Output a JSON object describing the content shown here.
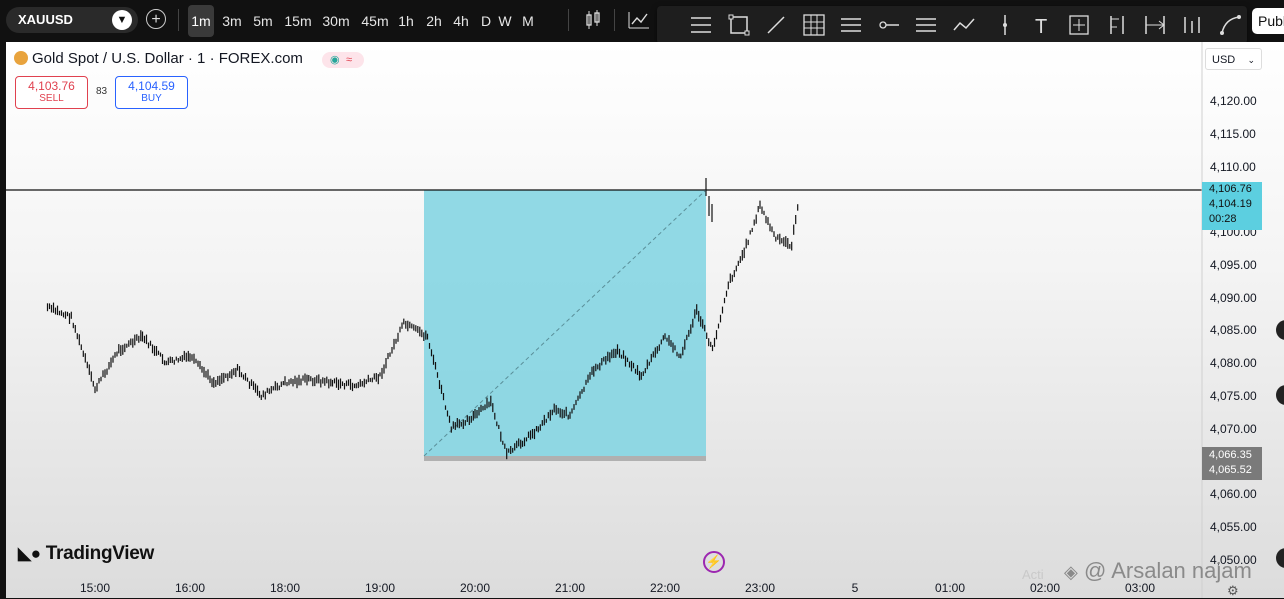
{
  "toolbar": {
    "symbol": "XAUUSD",
    "timeframes": [
      {
        "label": "1m",
        "active": true
      },
      {
        "label": "3m",
        "active": false
      },
      {
        "label": "5m",
        "active": false
      },
      {
        "label": "15m",
        "active": false
      },
      {
        "label": "30m",
        "active": false
      },
      {
        "label": "45m",
        "active": false
      },
      {
        "label": "1h",
        "active": false
      },
      {
        "label": "2h",
        "active": false
      },
      {
        "label": "4h",
        "active": false
      },
      {
        "label": "D",
        "active": false
      },
      {
        "label": "W",
        "active": false
      },
      {
        "label": "M",
        "active": false
      }
    ],
    "publish_label": "Publish"
  },
  "drawing_tools": [
    "fib-retracement-icon",
    "rectangle-icon",
    "trend-line-icon",
    "grid-icon",
    "long-position-icon",
    "horizontal-ray-icon",
    "parallel-channel-icon",
    "path-icon",
    "vertical-line-icon",
    "text-icon",
    "measure-icon",
    "pitchfork-icon",
    "date-range-icon",
    "bars-pattern-icon",
    "curve-icon"
  ],
  "chart": {
    "title": "Gold Spot / U.S. Dollar · 1 · FOREX.com",
    "sell": {
      "price": "4,103.76",
      "label": "SELL"
    },
    "buy": {
      "price": "4,104.59",
      "label": "BUY"
    },
    "spread": "83",
    "currency": "USD",
    "price_tag": {
      "line1": "4,106.76",
      "line2": "4,104.19",
      "line3": "00:28"
    },
    "range_tag": {
      "high": "4,066.35",
      "low": "4,065.52"
    },
    "branding": "TradingView",
    "watermark": "@ Arsalan najam",
    "activate_text": "Acti",
    "colors": {
      "accent": "#7fd3e2",
      "sell": "#e0414f",
      "buy": "#2962ff",
      "tag": "#5ccfe0"
    }
  },
  "chart_data": {
    "type": "line",
    "y_ticks": [
      "4,120.00",
      "4,115.00",
      "4,110.00",
      "4,105.00",
      "4,100.00",
      "4,095.00",
      "4,090.00",
      "4,085.00",
      "4,080.00",
      "4,075.00",
      "4,070.00",
      "4,065.00",
      "4,060.00",
      "4,055.00",
      "4,050.00"
    ],
    "x_ticks": [
      "15:00",
      "16:00",
      "18:00",
      "19:00",
      "20:00",
      "21:00",
      "22:00",
      "23:00",
      "5",
      "01:00",
      "02:00",
      "03:00"
    ],
    "ylim": [
      4050,
      4120
    ],
    "grid": false,
    "horizontal_line": 4106.76,
    "series": [
      {
        "x": [
          "14:30",
          "14:45",
          "15:00",
          "15:15",
          "15:30",
          "15:45",
          "16:00",
          "16:15",
          "16:30",
          "16:45",
          "17:00",
          "17:15",
          "17:30",
          "17:45",
          "18:00",
          "18:15",
          "18:30",
          "18:45",
          "19:00",
          "19:10",
          "19:20",
          "19:30",
          "19:40",
          "19:50",
          "20:00",
          "20:15",
          "20:30",
          "20:45",
          "21:00",
          "21:10",
          "21:20",
          "21:30",
          "21:40",
          "21:50",
          "22:00",
          "22:10",
          "22:20",
          "22:25"
        ],
        "values": [
          4088.5,
          4087,
          4076,
          4082,
          4084,
          4080,
          4081,
          4077,
          4079,
          4075,
          4077,
          4077.5,
          4077,
          4076.5,
          4078,
          4086,
          4084,
          4070,
          4072,
          4074,
          4066,
          4068,
          4070,
          4073,
          4072,
          4079,
          4082,
          4078,
          4084,
          4081,
          4088,
          4082,
          4092,
          4097,
          4104,
          4099,
          4098,
          4106
        ]
      }
    ]
  }
}
